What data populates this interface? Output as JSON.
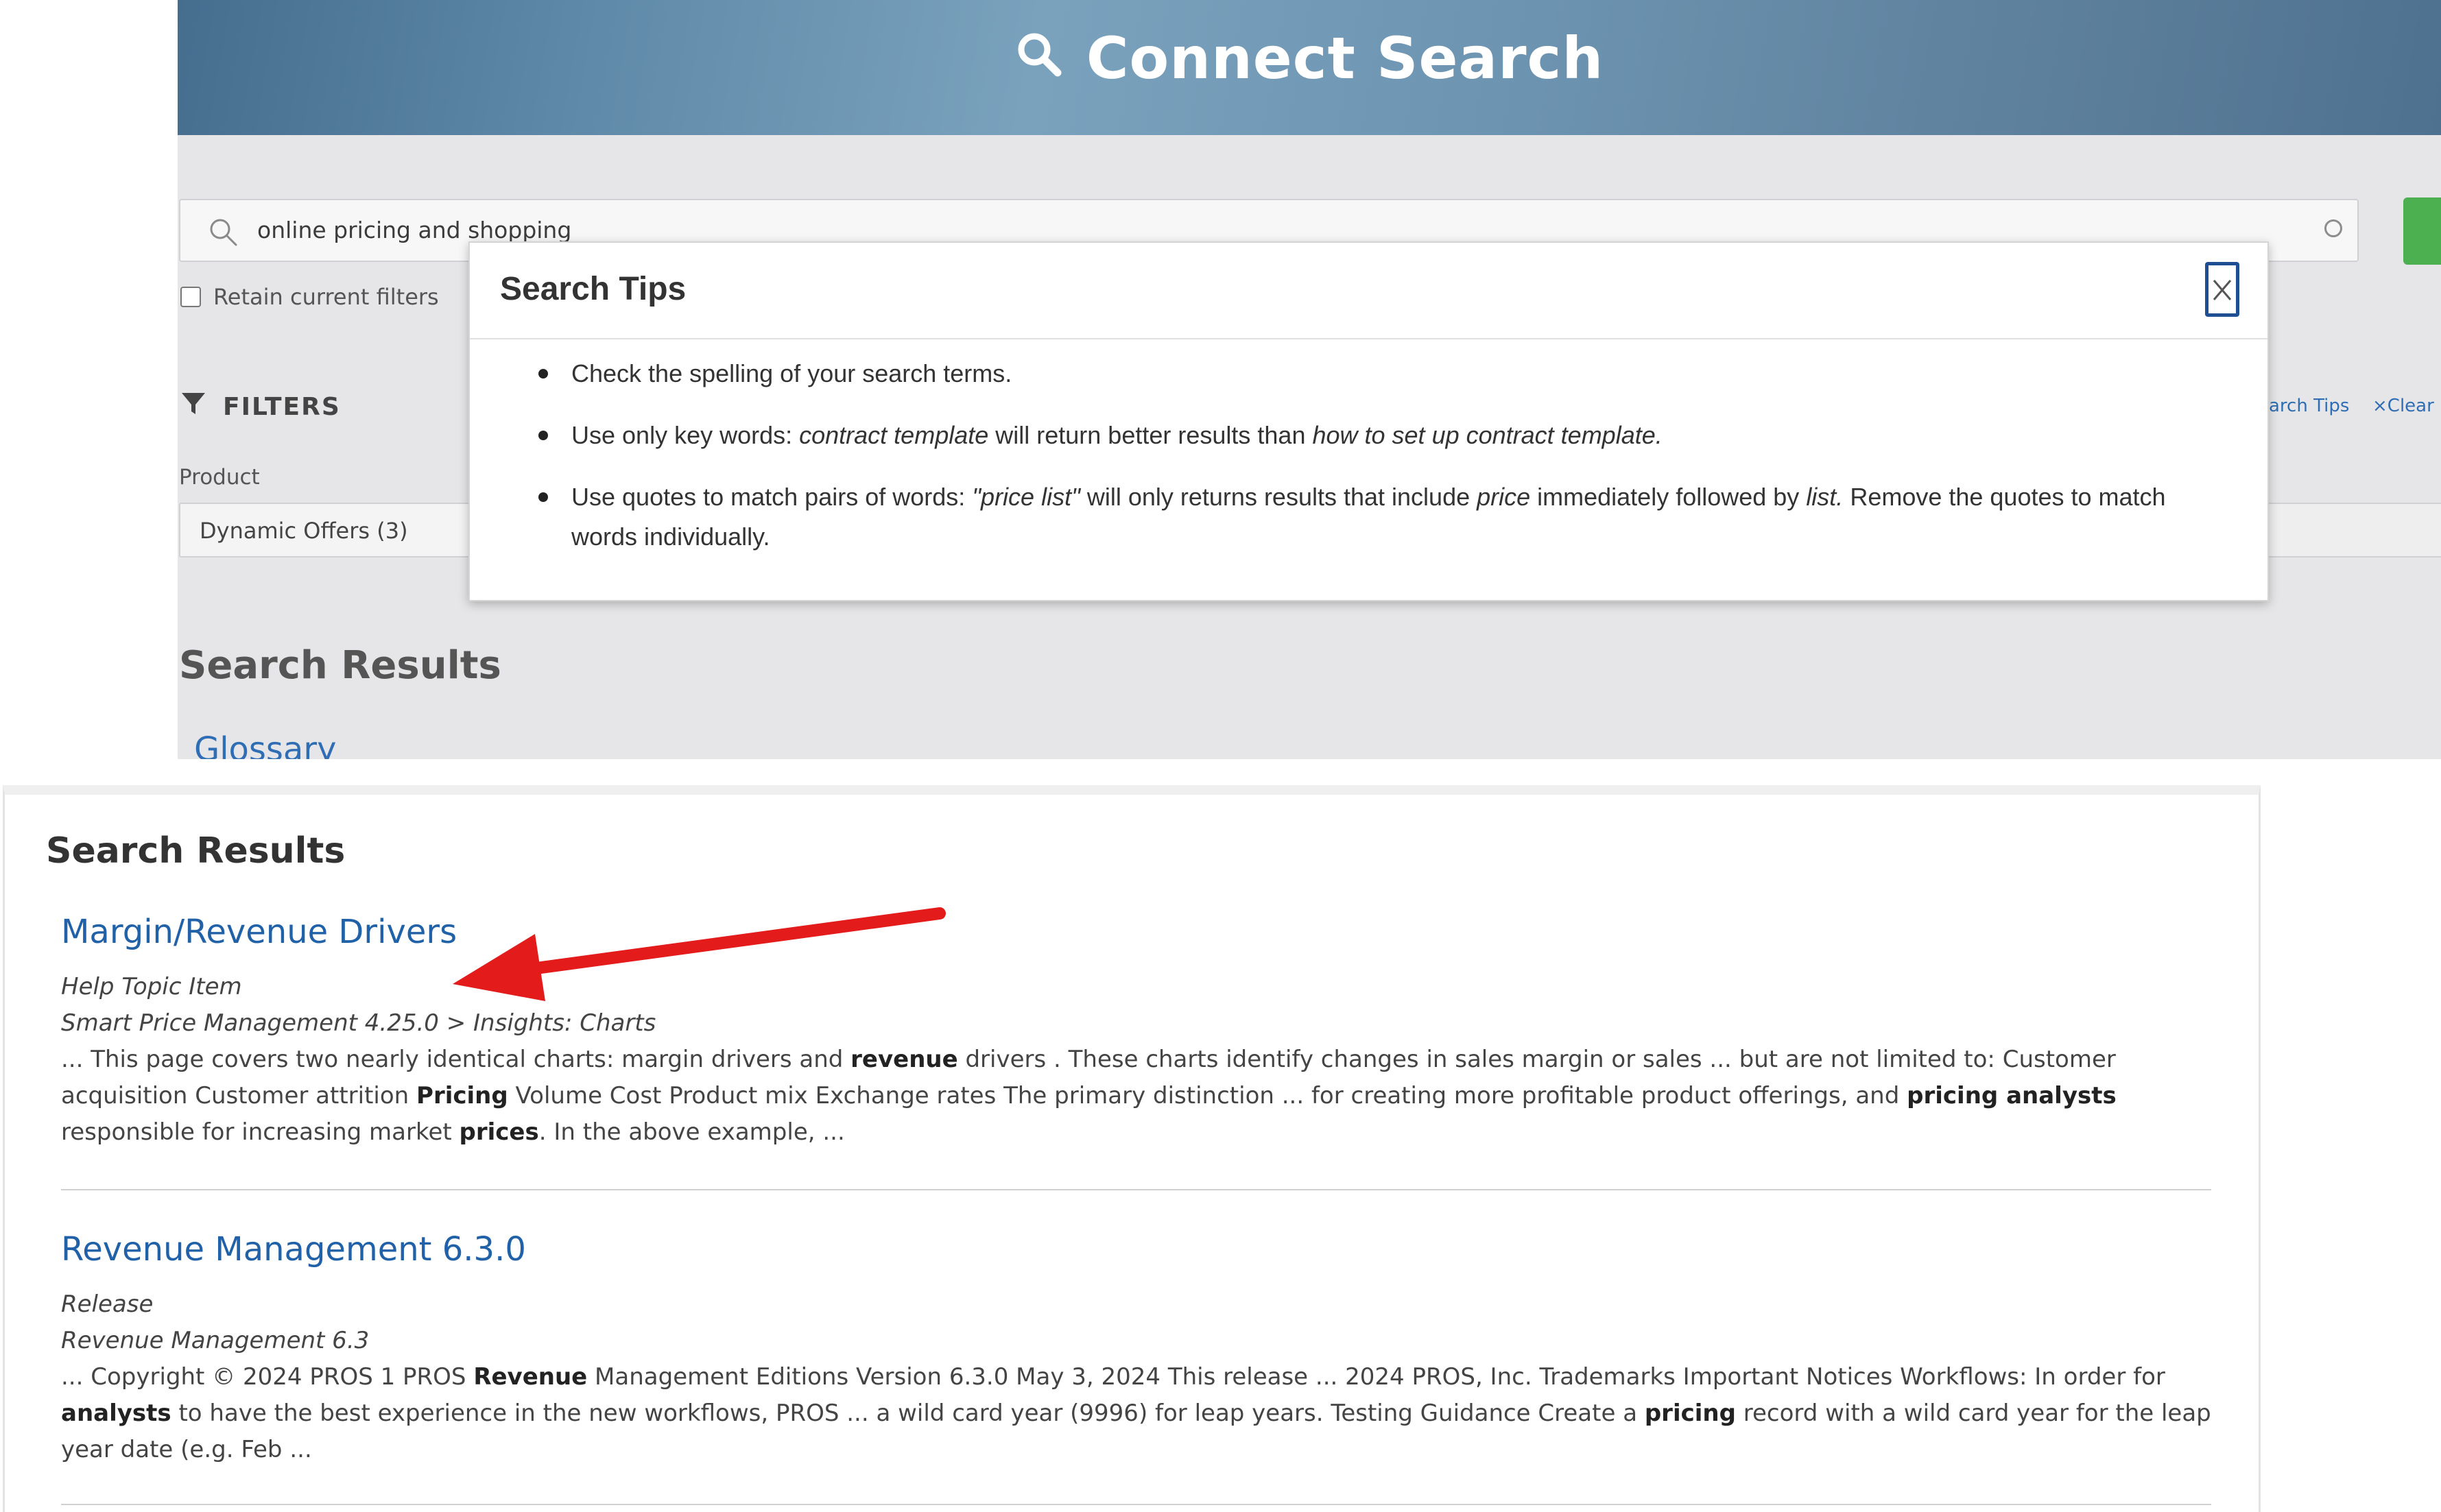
{
  "banner": {
    "title": "Connect Search"
  },
  "search": {
    "value": "online pricing and shopping"
  },
  "retain_filters": {
    "label": "Retain current filters"
  },
  "filters": {
    "label": "FILTERS",
    "product_label": "Product",
    "product_value": "Dynamic Offers (3)",
    "tips_link": "earch Tips",
    "clear_link": "×Clear"
  },
  "top_results": {
    "heading": "Search Results",
    "first_link": "Glossary"
  },
  "modal": {
    "title": "Search Tips",
    "tips": [
      [
        {
          "t": "Check the spelling of your search terms."
        }
      ],
      [
        {
          "t": "Use only key words: "
        },
        {
          "t": "contract template",
          "i": true
        },
        {
          "t": " will return better results than "
        },
        {
          "t": "how to set up contract template.",
          "i": true
        }
      ],
      [
        {
          "t": "Use quotes to match pairs of words: "
        },
        {
          "t": "\"price list\"",
          "i": true
        },
        {
          "t": " will only returns results that include "
        },
        {
          "t": "price",
          "i": true
        },
        {
          "t": " immediately followed by "
        },
        {
          "t": "list.",
          "i": true
        },
        {
          "t": " Remove the quotes to match words individually."
        }
      ]
    ]
  },
  "results": {
    "heading": "Search Results",
    "items": [
      {
        "title": "Margin/Revenue Drivers",
        "type": "Help Topic Item",
        "path": "Smart Price Management 4.25.0 > Insights: Charts",
        "snippet": [
          {
            "t": "... This page covers two nearly identical charts:  margin drivers  and  "
          },
          {
            "t": "revenue",
            "b": true
          },
          {
            "t": " drivers . These charts identify changes in sales margin or sales ... but are not limited to: Customer acquisition Customer attrition "
          },
          {
            "t": "Pricing",
            "b": true
          },
          {
            "t": " Volume Cost Product mix Exchange rates The primary distinction ... for creating more profitable product offerings, and "
          },
          {
            "t": "pricing analysts",
            "b": true
          },
          {
            "t": " responsible for increasing market "
          },
          {
            "t": "prices",
            "b": true
          },
          {
            "t": ". In the above example, ..."
          }
        ]
      },
      {
        "title": "Revenue Management 6.3.0",
        "type": "Release",
        "path": "Revenue Management 6.3",
        "snippet": [
          {
            "t": "... Copyright © 2024 PROS 1 PROS "
          },
          {
            "t": "Revenue",
            "b": true
          },
          {
            "t": " Management Editions Version 6.3.0 May 3, 2024 This release ... 2024 PROS, Inc. Trademarks Important Notices Workflows:  In order for "
          },
          {
            "t": "analysts",
            "b": true
          },
          {
            "t": " to have the best experience in the new workflows, PROS ... a wild card year (9996) for leap years.  Testing Guidance Create a "
          },
          {
            "t": "pricing",
            "b": true
          },
          {
            "t": " record with a wild card year for the leap year date (e.g. Feb ..."
          }
        ]
      }
    ]
  },
  "colors": {
    "link": "#2061a8",
    "accent_green": "#4caf50",
    "annotation_arrow": "#e31b1b"
  }
}
